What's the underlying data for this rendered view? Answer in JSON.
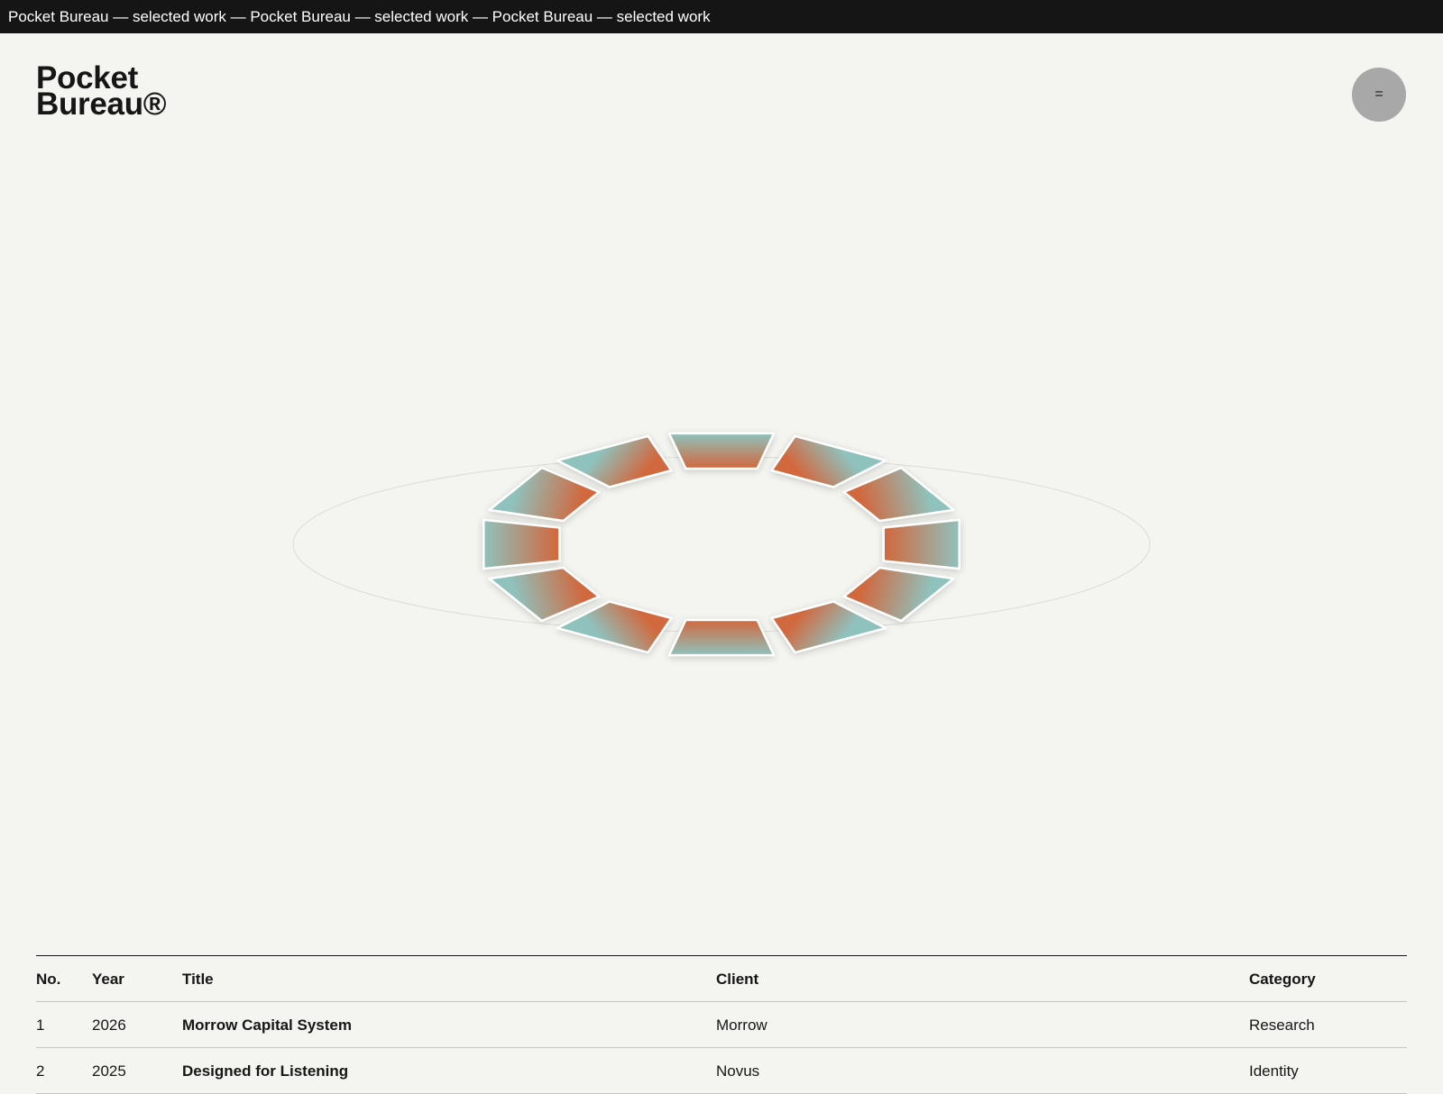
{
  "ticker": {
    "text": "Pocket Bureau — selected work — Pocket Bureau — selected work — Pocket Bureau — selected work"
  },
  "brand": {
    "line1": "Pocket",
    "line2": "Bureau®"
  },
  "menu": {
    "label": "="
  },
  "carousel": {
    "tile_count": 12,
    "colors": {
      "warm": "#d2673c",
      "cool": "#8fc2bd",
      "tile_border": "#ffffff",
      "orbit_line": "#dcdcd6"
    }
  },
  "table": {
    "headers": {
      "no": "No.",
      "year": "Year",
      "title": "Title",
      "client": "Client",
      "category": "Category"
    },
    "rows": [
      {
        "no": "1",
        "year": "2026",
        "title": "Morrow Capital System",
        "client": "Morrow",
        "category": "Research"
      },
      {
        "no": "2",
        "year": "2025",
        "title": "Designed for Listening",
        "client": "Novus",
        "category": "Identity"
      }
    ]
  }
}
